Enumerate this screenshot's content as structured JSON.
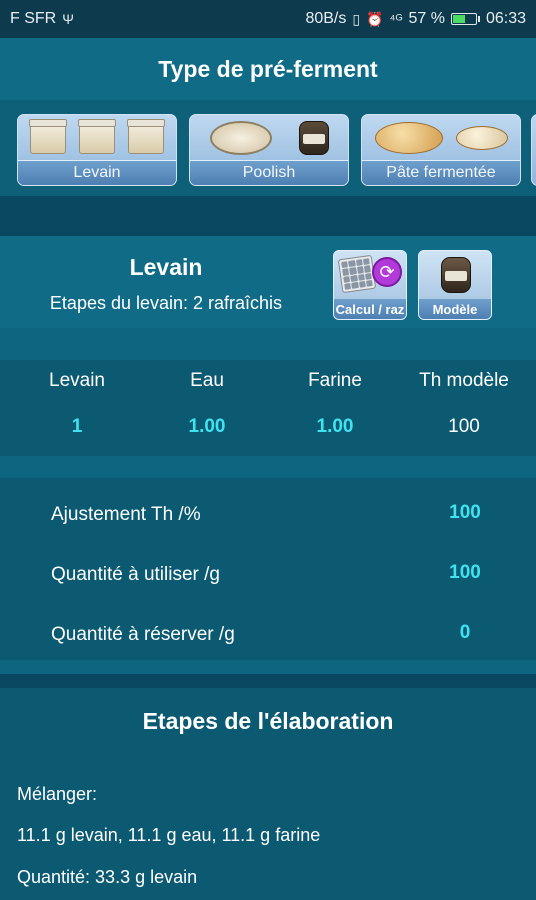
{
  "status": {
    "carrier": "F SFR",
    "usb": "Ψ",
    "speed": "80B/s",
    "vibrate": "▯",
    "alarm": "⏰",
    "signal": "⁴ᴳ",
    "battery": "57 %",
    "time": "06:33"
  },
  "header": {
    "title": "Type de pré-ferment"
  },
  "types": [
    {
      "label": "Levain",
      "icon": "levain-jars"
    },
    {
      "label": "Poolish",
      "icon": "poolish-bowl"
    },
    {
      "label": "Pâte fermentée",
      "icon": "bread-loaves"
    }
  ],
  "levain": {
    "title": "Levain",
    "subtitle": "Etapes du levain: 2 rafraîchis",
    "calc_label": "Calcul / raz",
    "model_label": "Modèle"
  },
  "table": {
    "headers": [
      "Levain",
      "Eau",
      "Farine",
      "Th modèle"
    ],
    "row": [
      "1",
      "1.00",
      "1.00",
      "100"
    ]
  },
  "adjust": [
    {
      "label": "Ajustement Th /%",
      "value": "100"
    },
    {
      "label": "Quantité à utiliser /g",
      "value": "100"
    },
    {
      "label": "Quantité à réserver /g",
      "value": "0"
    }
  ],
  "etapes": {
    "title": "Etapes de l'élaboration",
    "lines": [
      "Mélanger:",
      "11.1 g levain, 11.1 g eau, 11.1 g farine",
      "Quantité: 33.3 g levain"
    ]
  }
}
